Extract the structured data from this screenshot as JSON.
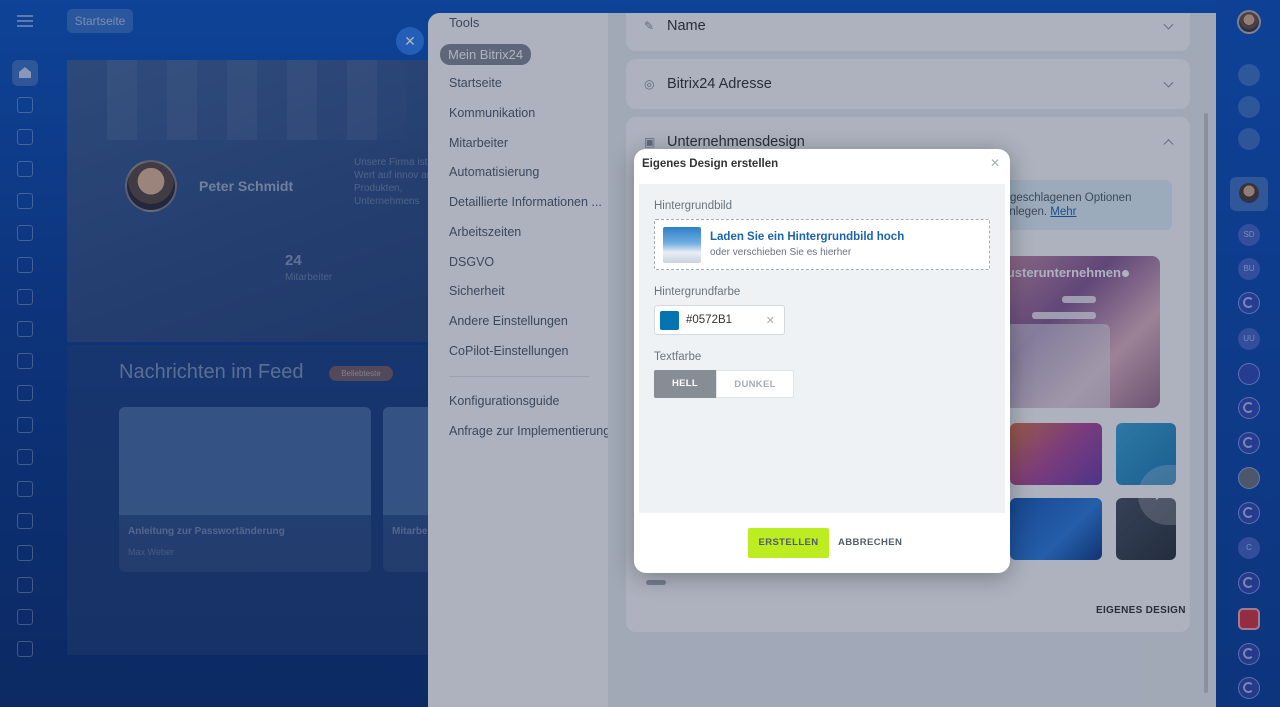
{
  "background": {
    "chip_label": "Startseite",
    "user_name": "Peter Schmidt",
    "company_desc": "Unsere Firma ist Wert auf innov an Produkten, Unternehmens",
    "employee_count": "24",
    "employee_label": "Mitarbeiter",
    "feed_title": "Nachrichten im Feed",
    "feed_badge": "Beliebteste",
    "card1_title": "Anleitung zur Passwortänderung",
    "card1_author": "Max Weber",
    "card2_title": "Mitarbeit"
  },
  "right_rail": {
    "avatar_labels": [
      "SD",
      "BU",
      "UU",
      "C"
    ]
  },
  "settings_nav": {
    "tools_label": "Tools",
    "section_label": "Mein Bitrix24",
    "items": [
      "Startseite",
      "Kommunikation",
      "Mitarbeiter",
      "Automatisierung",
      "Detaillierte Informationen ...",
      "Arbeitszeiten",
      "DSGVO",
      "Sicherheit",
      "Andere Einstellungen",
      "CoPilot-Einstellungen"
    ],
    "extra_items": [
      "Konfigurationsguide",
      "Anfrage zur Implementierung"
    ]
  },
  "settings_main": {
    "section_name": "Name",
    "section_address": "Bitrix24 Adresse",
    "section_design": "Unternehmensdesign",
    "hint_text": "vorgeschlagenen Optionen",
    "hint_text2": "y anlegen.",
    "hint_link": "Mehr",
    "preview_label": "Musterunternehmen",
    "own_design_label": "EIGENES DESIGN"
  },
  "dialog": {
    "title": "Eigenes Design erstellen",
    "bg_image_label": "Hintergrundbild",
    "upload_title": "Laden Sie ein Hintergrundbild hoch",
    "upload_subtitle": "oder verschieben Sie es hierher",
    "bg_color_label": "Hintergrundfarbe",
    "bg_color_value": "#0572B1",
    "text_color_label": "Textfarbe",
    "text_light": "HELL",
    "text_dark": "DUNKEL",
    "create_button": "ERSTELLEN",
    "cancel_button": "ABBRECHEN"
  },
  "colors": {
    "accent_green": "#bbed21",
    "link_blue": "#1d64b0",
    "selected_color": "#0572B1"
  }
}
